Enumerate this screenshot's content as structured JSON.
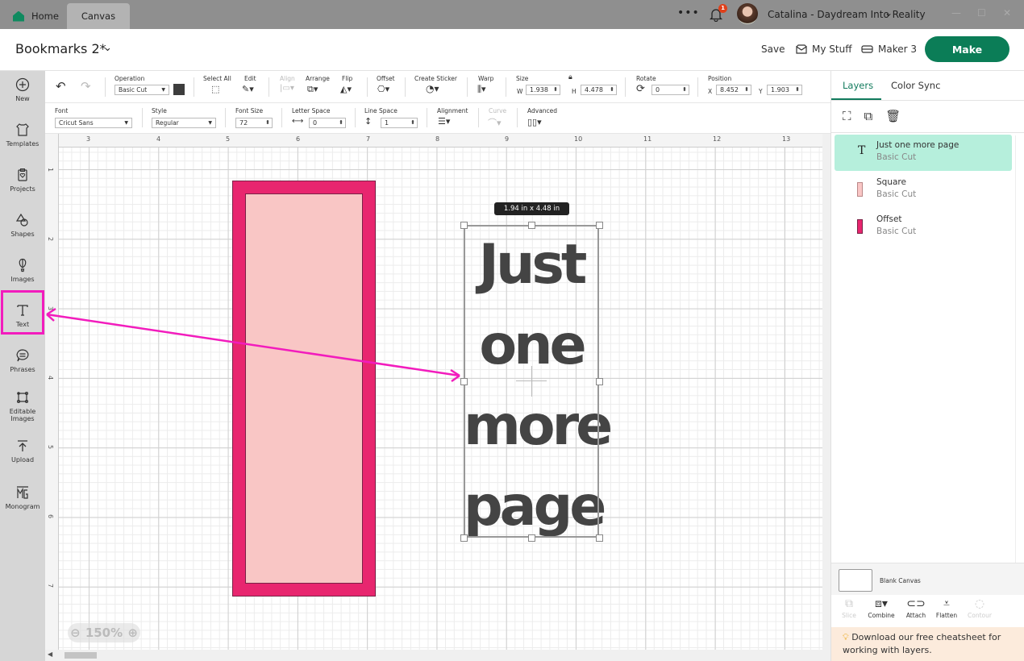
{
  "titlebar": {
    "tabs": [
      {
        "label": "Home",
        "icon": "home-icon"
      },
      {
        "label": "Canvas"
      }
    ],
    "more_label": "•••",
    "notification_count": "1",
    "user_name": "Catalina - Daydream Into Reality",
    "window_controls": [
      "—",
      "☐",
      "✕"
    ]
  },
  "header": {
    "project_title": "Bookmarks 2*",
    "save_label": "Save",
    "my_stuff_label": "My Stuff",
    "machine_label": "Maker 3",
    "make_label": "Make"
  },
  "sidebar": {
    "items": [
      {
        "label": "New",
        "icon": "plus-circle-icon"
      },
      {
        "label": "Templates",
        "icon": "shirt-icon"
      },
      {
        "label": "Projects",
        "icon": "clipboard-heart-icon"
      },
      {
        "label": "Shapes",
        "icon": "shapes-icon"
      },
      {
        "label": "Images",
        "icon": "balloon-icon"
      },
      {
        "label": "Text",
        "icon": "text-icon"
      },
      {
        "label": "Phrases",
        "icon": "speech-bubble-icon"
      },
      {
        "label": "Editable",
        "label2": "Images",
        "icon": "editable-image-icon"
      },
      {
        "label": "Upload",
        "icon": "upload-icon"
      },
      {
        "label": "Monogram",
        "icon": "monogram-icon"
      }
    ],
    "highlighted": "Text"
  },
  "toolbar": {
    "operation_label": "Operation",
    "operation_value": "Basic Cut",
    "operation_color": "#3d3d3d",
    "select_all_label": "Select All",
    "edit_label": "Edit",
    "align_label": "Align",
    "arrange_label": "Arrange",
    "flip_label": "Flip",
    "offset_label": "Offset",
    "create_sticker_label": "Create Sticker",
    "warp_label": "Warp",
    "size_label": "Size",
    "width_prefix": "W",
    "width_value": "1.938",
    "height_prefix": "H",
    "height_value": "4.478",
    "rotate_label": "Rotate",
    "rotate_value": "0",
    "position_label": "Position",
    "x_prefix": "X",
    "x_value": "8.452",
    "y_prefix": "Y",
    "y_value": "1.903"
  },
  "text_toolbar": {
    "font_label": "Font",
    "font_value": "Cricut Sans",
    "style_label": "Style",
    "style_value": "Regular",
    "font_size_label": "Font Size",
    "font_size_value": "72",
    "letter_space_label": "Letter Space",
    "letter_space_value": "0",
    "line_space_label": "Line Space",
    "line_space_value": "1",
    "alignment_label": "Alignment",
    "curve_label": "Curve",
    "advanced_label": "Advanced"
  },
  "canvas": {
    "ruler_top": [
      "3",
      "4",
      "5",
      "6",
      "7",
      "8",
      "9",
      "10",
      "11",
      "12",
      "13"
    ],
    "ruler_left": [
      "1",
      "2",
      "3",
      "4",
      "5",
      "6",
      "7"
    ],
    "dimension_tooltip": "1.94  in x 4.48  in",
    "text_lines": [
      "Just",
      "one",
      "more",
      "page"
    ],
    "zoom_level": "150%",
    "offset_color": "#e8266f",
    "square_color": "#f9c6c5",
    "annotation_color": "#f21cbd"
  },
  "layers_panel": {
    "tabs": [
      "Layers",
      "Color Sync"
    ],
    "active_tab": "Layers",
    "layers": [
      {
        "name": "Just one more page",
        "operation": "Basic Cut",
        "icon": "text-icon",
        "selected": true
      },
      {
        "name": "Square",
        "operation": "Basic Cut",
        "icon": "square-swatch-icon",
        "color": "#f9c6c5"
      },
      {
        "name": "Offset",
        "operation": "Basic Cut",
        "icon": "offset-swatch-icon",
        "color": "#e8266f"
      }
    ],
    "blank_canvas_label": "Blank Canvas",
    "bottom_tools": [
      {
        "label": "Slice",
        "enabled": false
      },
      {
        "label": "Combine",
        "enabled": true
      },
      {
        "label": "Attach",
        "enabled": true
      },
      {
        "label": "Flatten",
        "enabled": true
      },
      {
        "label": "Contour",
        "enabled": false
      }
    ],
    "tip_text": "Download our free cheatsheet for working with layers."
  }
}
